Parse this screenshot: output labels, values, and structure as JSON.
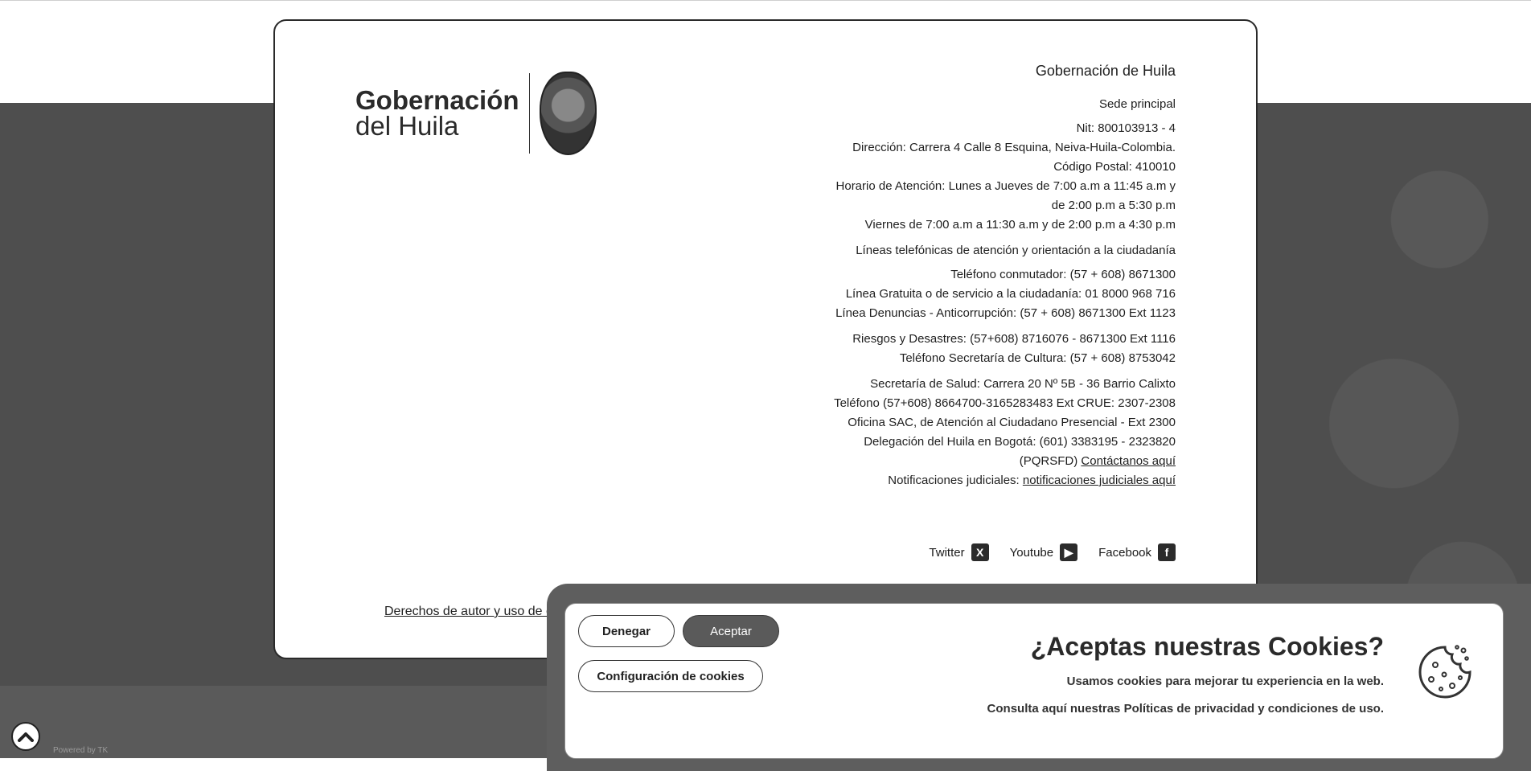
{
  "org_name": "Gobernación de Huila",
  "logo": {
    "line1": "Gobernación",
    "line2": "del Huila"
  },
  "sede": {
    "title": "Sede principal",
    "lines": [
      "Nit: 800103913 - 4",
      "Dirección: Carrera 4 Calle 8 Esquina, Neiva-Huila-Colombia.",
      "Código Postal: 410010",
      "Horario de Atención: Lunes a Jueves de 7:00 a.m a 11:45 a.m y",
      "de 2:00 p.m a 5:30 p.m",
      "Viernes de 7:00 a.m a 11:30 a.m y de 2:00 p.m a 4:30 p.m"
    ]
  },
  "lineas": {
    "title": "Líneas telefónicas de atención y orientación a la ciudadanía",
    "lines": [
      "Teléfono conmutador: (57 + 608) 8671300",
      "Línea Gratuita o de servicio a la ciudadanía: 01 8000 968 716",
      "Línea Denuncias - Anticorrupción: (57 + 608) 8671300 Ext 1123"
    ]
  },
  "riesgos": [
    "Riesgos y Desastres: (57+608) 8716076 - 8671300 Ext 1116",
    "Teléfono Secretaría de Cultura: (57 + 608) 8753042"
  ],
  "salud": [
    "Secretaría de Salud: Carrera 20 Nº 5B - 36 Barrio Calixto",
    "Teléfono (57+608) 8664700-3165283483 Ext CRUE: 2307-2308",
    "Oficina SAC, de Atención al Ciudadano Presencial - Ext 2300",
    "Delegación del Huila en Bogotá: (601) 3383195 - 2323820"
  ],
  "pqrsfd": {
    "prefix": "(PQRSFD) ",
    "link": "Contáctanos aquí"
  },
  "notificaciones": {
    "prefix": "Notificaciones judiciales: ",
    "link": "notificaciones judiciales aquí"
  },
  "social": [
    {
      "icon": "facebook-icon",
      "glyph": "f",
      "label": "Facebook"
    },
    {
      "icon": "youtube-icon",
      "glyph": "▶",
      "label": "Youtube"
    },
    {
      "icon": "twitter-icon",
      "glyph": "X",
      "label": "Twitter"
    }
  ],
  "rights_link": "Derechos de autor y uso de contenidos",
  "cookie": {
    "title": "¿Aceptas nuestras Cookies?",
    "text1": "Usamos cookies para mejorar tu experiencia en la web.",
    "text2": "Consulta aquí nuestras Políticas de privacidad y condiciones de uso.",
    "accept": "Aceptar",
    "deny": "Denegar",
    "config": "Configuración de cookies"
  },
  "powered": "Powered by TK"
}
